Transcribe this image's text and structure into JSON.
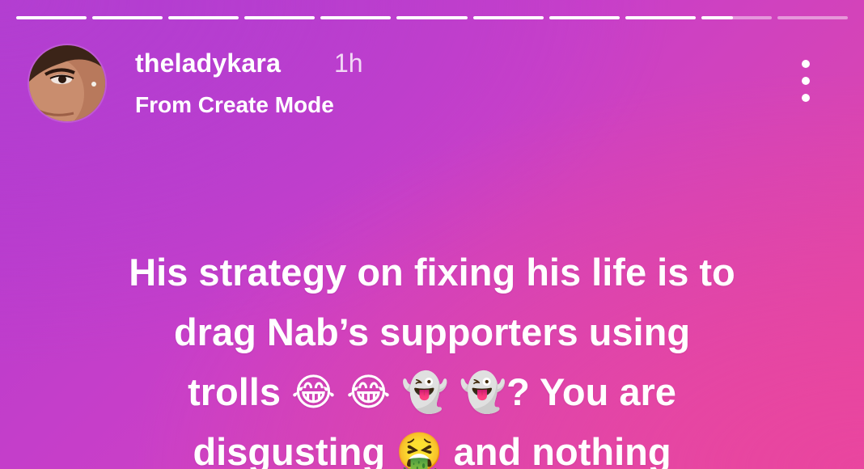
{
  "story": {
    "segments_total": 11,
    "segments_completed": 9,
    "current_segment_progress": 0.45,
    "username": "theladykara",
    "time_ago": "1h",
    "subtitle": "From Create Mode",
    "text_lines": [
      "His strategy on fixing his life is to",
      "drag Nab’s supporters using",
      "trolls 😂 😂 👻 👻? You are",
      "disgusting 🤮  and nothing"
    ]
  },
  "icons": {
    "more": "more-vertical-icon"
  },
  "colors": {
    "gradient_start": "#b23ad0",
    "gradient_end": "#e7499f",
    "text": "#ffffff"
  }
}
